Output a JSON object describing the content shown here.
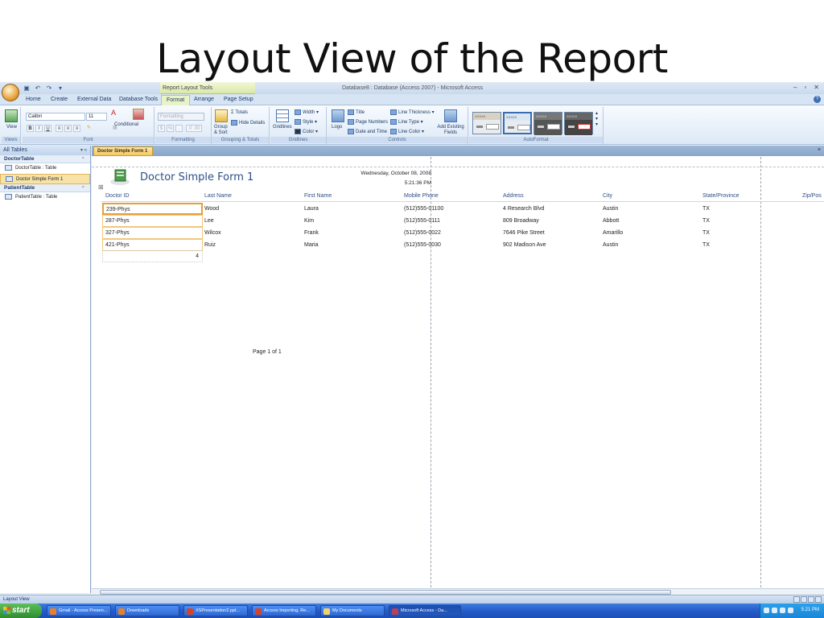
{
  "slide": {
    "title": "Layout View of the Report"
  },
  "app": {
    "context_tab": "Report Layout Tools",
    "window_title": "Database8 : Database (Access 2007) - Microsoft Access",
    "controls": {
      "minimize": "–",
      "restore": "▫",
      "close": "✕"
    }
  },
  "tabs": [
    "Home",
    "Create",
    "External Data",
    "Database Tools",
    "Format",
    "Arrange",
    "Page Setup"
  ],
  "active_tab": "Format",
  "ribbon": {
    "views": {
      "view": "View",
      "label": "Views"
    },
    "font": {
      "family": "Calibri",
      "size": "11",
      "label": "Font",
      "bold": "B",
      "italic": "I",
      "underline": "U"
    },
    "formatting": {
      "format_combo": "Formatting",
      "conditional": "Conditional",
      "label": "Formatting",
      "currency": "$",
      "percent": "%",
      "comma": ","
    },
    "grouping": {
      "group_sort": "Group\n& Sort",
      "totals": "Σ Totals",
      "hide_details": "Hide Details",
      "label": "Grouping & Totals"
    },
    "gridlines": {
      "gridlines": "Gridlines",
      "width": "Width",
      "style": "Style",
      "color": "Color",
      "label": "Gridlines"
    },
    "controls": {
      "logo": "Logo",
      "title": "Title",
      "page_numbers": "Page Numbers",
      "date_time": "Date and Time",
      "line_thickness": "Line Thickness",
      "line_type": "Line Type",
      "line_color": "Line Color",
      "add_fields": "Add Existing Fields",
      "label": "Controls"
    },
    "autoformat": {
      "label": "AutoFormat",
      "sample": "XXXXX"
    }
  },
  "nav": {
    "header": "All Tables",
    "groups": [
      {
        "name": "DoctorTable",
        "items": [
          "DoctorTable : Table",
          "Doctor Simple Form 1"
        ]
      },
      {
        "name": "PatientTable",
        "items": [
          "PatientTable : Table"
        ]
      }
    ]
  },
  "document": {
    "tab": "Doctor Simple Form 1",
    "close": "×",
    "report_title": "Doctor Simple Form 1",
    "date": "Wednesday, October 08, 2008",
    "time": "5:21:36 PM",
    "columns": [
      "Doctor ID",
      "Last Name",
      "First Name",
      "Mobile Phone",
      "Address",
      "City",
      "State/Province",
      "Zip/Pos"
    ],
    "rows": [
      [
        "239-Phys",
        "Wood",
        "Laura",
        "(512)555-01100",
        "4 Research Blvd",
        "Austin",
        "TX"
      ],
      [
        "287-Phys",
        "Lee",
        "Kim",
        "(512)555-0111",
        "809 Broadway",
        "Abbott",
        "TX"
      ],
      [
        "327-Phys",
        "Wilcox",
        "Frank",
        "(512)555-0022",
        "7646 Pike Street",
        "Amarillo",
        "TX"
      ],
      [
        "421-Phys",
        "Ruiz",
        "Maria",
        "(512)555-0030",
        "902 Madison Ave",
        "Austin",
        "TX"
      ]
    ],
    "count": "4",
    "page_footer": "Page 1 of 1"
  },
  "status": {
    "text": "Layout View"
  },
  "taskbar": {
    "start": "start",
    "buttons": [
      "Gmail - Access Presen...",
      "Downloads",
      "XSPresentation2.ppt...",
      "Access Importing, Re...",
      "My Documents",
      "Microsoft Access - Da..."
    ],
    "clock": "5:21 PM"
  }
}
